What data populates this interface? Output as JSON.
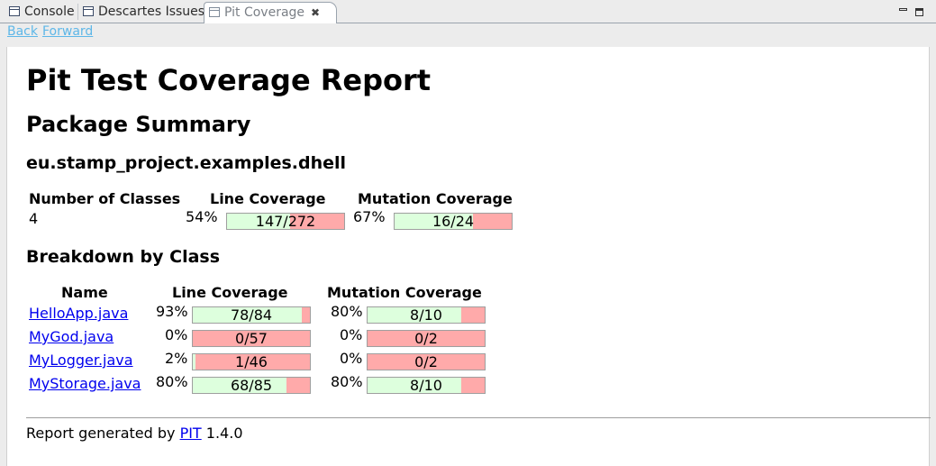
{
  "tabs": [
    {
      "label": "Console",
      "icon": "console-icon"
    },
    {
      "label": "Descartes Issues",
      "icon": "view-icon"
    },
    {
      "label": "Pit Coverage",
      "icon": "view-icon",
      "active": true
    }
  ],
  "nav": {
    "back": "Back",
    "forward": "Forward"
  },
  "report": {
    "title": "Pit Test Coverage Report",
    "package_summary_heading": "Package Summary",
    "package_name": "eu.stamp_project.examples.dhell",
    "summary": {
      "headers": {
        "classes": "Number of Classes",
        "line": "Line Coverage",
        "mutation": "Mutation Coverage"
      },
      "num_classes": "4",
      "line_pct": "54%",
      "line_ratio": "147/272",
      "line_fraction": 0.54,
      "mutation_pct": "67%",
      "mutation_ratio": "16/24",
      "mutation_fraction": 0.67
    },
    "breakdown_heading": "Breakdown by Class",
    "breakdown_headers": {
      "name": "Name",
      "line": "Line Coverage",
      "mutation": "Mutation Coverage"
    },
    "classes": [
      {
        "name": "HelloApp.java",
        "line_pct": "93%",
        "line_ratio": "78/84",
        "line_fraction": 0.93,
        "mut_pct": "80%",
        "mut_ratio": "8/10",
        "mut_fraction": 0.8
      },
      {
        "name": "MyGod.java",
        "line_pct": "0%",
        "line_ratio": "0/57",
        "line_fraction": 0,
        "mut_pct": "0%",
        "mut_ratio": "0/2",
        "mut_fraction": 0
      },
      {
        "name": "MyLogger.java",
        "line_pct": "2%",
        "line_ratio": "1/46",
        "line_fraction": 0.02,
        "mut_pct": "0%",
        "mut_ratio": "0/2",
        "mut_fraction": 0
      },
      {
        "name": "MyStorage.java",
        "line_pct": "80%",
        "line_ratio": "68/85",
        "line_fraction": 0.8,
        "mut_pct": "80%",
        "mut_ratio": "8/10",
        "mut_fraction": 0.8
      }
    ],
    "footer": {
      "prefix": "Report generated by ",
      "link": "PIT",
      "suffix": " 1.4.0"
    }
  },
  "colors": {
    "covered": "#ddffdd",
    "uncovered": "#ffaaaa",
    "link": "#0000ee",
    "nav_link": "#5eb7e8"
  }
}
